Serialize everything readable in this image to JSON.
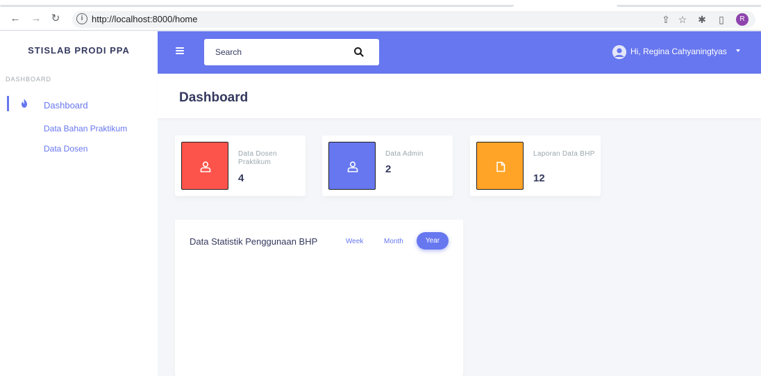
{
  "browser": {
    "url": "http://localhost:8000/home",
    "profile_initial": "R"
  },
  "sidebar": {
    "brand": "STISLAB PRODI PPA",
    "menu_header": "DASHBOARD",
    "items": [
      {
        "label": "Dashboard",
        "active": true
      },
      {
        "label": "Data Bahan Praktikum"
      },
      {
        "label": "Data Dosen"
      }
    ]
  },
  "topbar": {
    "search_placeholder": "Search",
    "user_greeting": "Hi, Regina Cahyaningtyas"
  },
  "page": {
    "title": "Dashboard"
  },
  "stats": [
    {
      "label": "Data Dosen Praktikum",
      "value": "4",
      "color": "#fc544b",
      "icon": "user-icon"
    },
    {
      "label": "Data Admin",
      "value": "2",
      "color": "#6777ef",
      "icon": "user-icon"
    },
    {
      "label": "Laporan Data BHP",
      "value": "12",
      "color": "#ffa426",
      "icon": "file-icon"
    }
  ],
  "statistic": {
    "title": "Data Statistik Penggunaan BHP",
    "tabs": [
      "Week",
      "Month",
      "Year"
    ],
    "active_tab": "Year"
  },
  "colors": {
    "primary": "#6777ef",
    "danger": "#fc544b",
    "warning": "#ffa426"
  }
}
